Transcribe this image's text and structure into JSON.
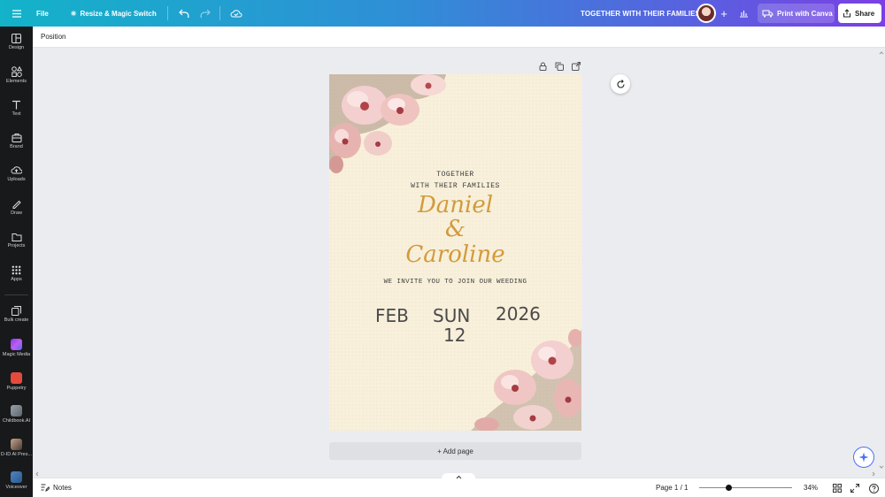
{
  "topbar": {
    "file_label": "File",
    "resize_label": "Resize & Magic Switch",
    "doc_title": "TOGETHER WITH THEIR FAMILIES",
    "print_label": "Print with Canva",
    "share_label": "Share"
  },
  "rail": {
    "items": [
      {
        "label": "Design",
        "icon": "design-icon"
      },
      {
        "label": "Elements",
        "icon": "elements-icon"
      },
      {
        "label": "Text",
        "icon": "text-icon"
      },
      {
        "label": "Brand",
        "icon": "brand-icon"
      },
      {
        "label": "Uploads",
        "icon": "uploads-icon"
      },
      {
        "label": "Draw",
        "icon": "draw-icon"
      },
      {
        "label": "Projects",
        "icon": "projects-icon"
      },
      {
        "label": "Apps",
        "icon": "apps-icon"
      },
      {
        "label": "Bulk create",
        "icon": "bulk-create-icon"
      },
      {
        "label": "Magic Media",
        "icon": "magic-media-icon"
      },
      {
        "label": "Puppetry",
        "icon": "puppetry-icon"
      },
      {
        "label": "Childbook.AI",
        "icon": "childbook-icon"
      },
      {
        "label": "D-ID AI Pres...",
        "icon": "d-id-icon"
      },
      {
        "label": "Voiceover",
        "icon": "voiceover-icon"
      }
    ]
  },
  "subbar": {
    "position_label": "Position"
  },
  "invitation": {
    "line1": "TOGETHER",
    "line2": "WITH THEIR FAMILIES",
    "name1": "Daniel",
    "amp": "&",
    "name2": "Caroline",
    "invite": "WE INVITE YOU TO JOIN OUR WEEDING",
    "month": "FEB",
    "day_name": "SUN",
    "day_num": "12",
    "year": "2026"
  },
  "canvas": {
    "add_page_label": "+ Add page"
  },
  "bottombar": {
    "notes_label": "Notes",
    "page_label": "Page 1 / 1",
    "zoom_label": "34%",
    "zoom_percent": 34
  },
  "colors": {
    "accent_gradient_start": "#13b3c9",
    "accent_gradient_end": "#7b3fe4",
    "script_gold": "#d39a3c",
    "paper": "#f8f0da"
  }
}
